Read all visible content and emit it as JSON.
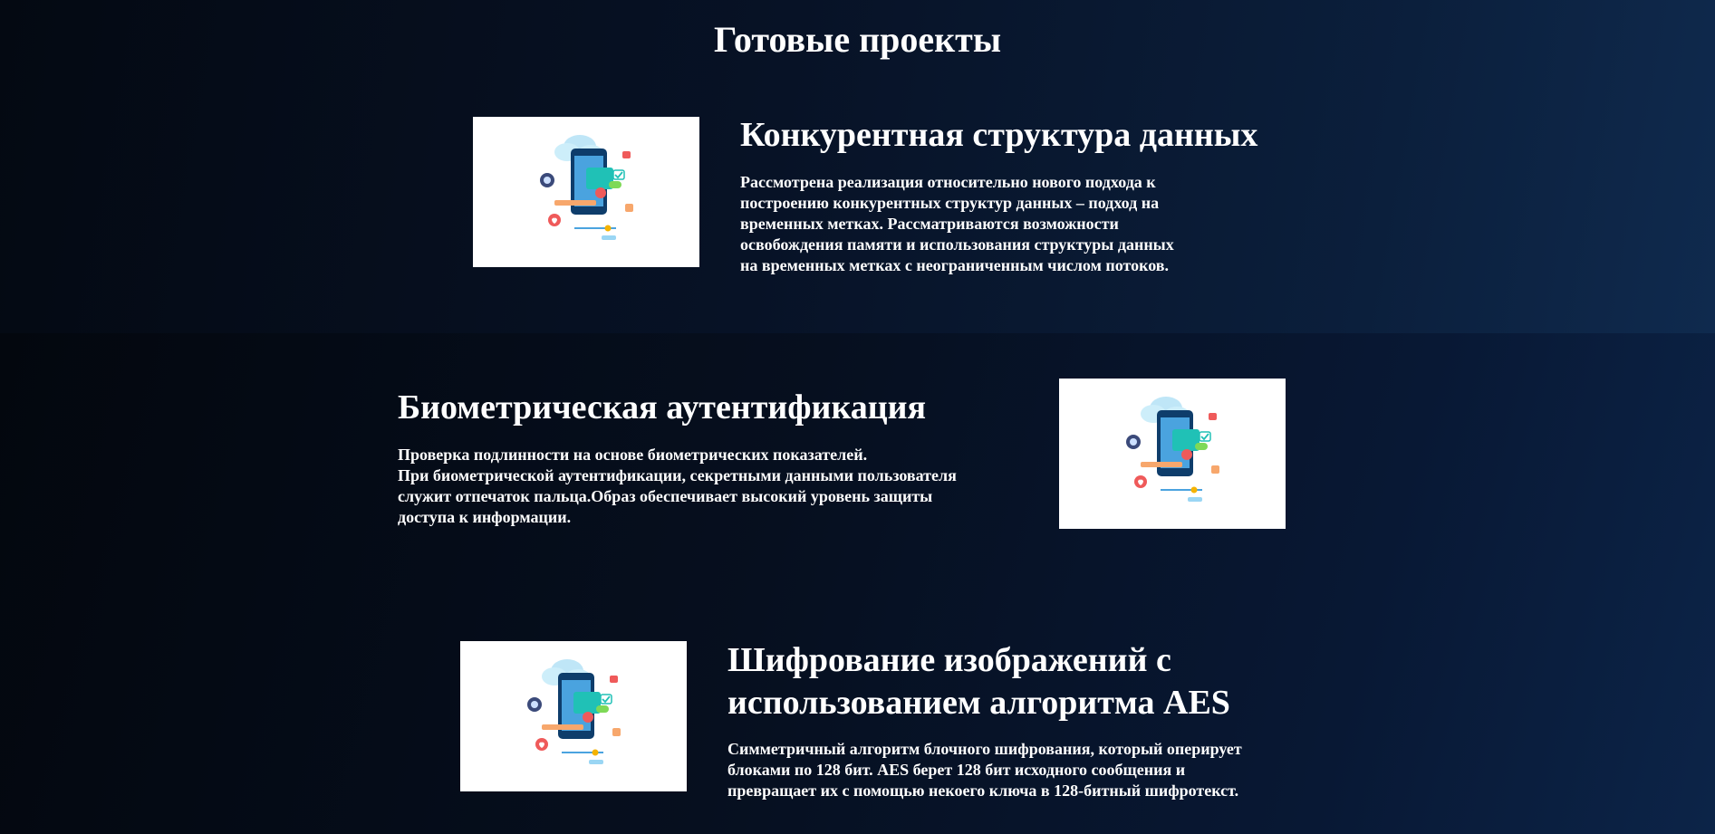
{
  "page": {
    "title": "Готовые проекты"
  },
  "projects": [
    {
      "title": "Конкурентная структура данных",
      "description": "Рассмотрена реализация относительно нового подхода к\nпостроению конкурентных структур данных – подход на\nвременных метках. Рассматриваются возможности\nосвобождения памяти и использования структуры данных\nна временных метках с неограниченным числом потоков.",
      "image_icon": "mobile-app-illustration-icon"
    },
    {
      "title": "Биометрическая аутентификация",
      "description": "Проверка подлинности на основе биометрических показателей.\nПри биометрической аутентификации, секретными данными пользователя\nслужит отпечаток пальца.Образ обеспечивает высокий уровень защиты\nдоступа к информации.",
      "image_icon": "mobile-app-illustration-icon"
    },
    {
      "title": "Шифрование изображений с\nиспользованием алгоритма AES",
      "description": "Симметричный алгоритм блочного шифрования, который оперирует\nблоками по 128 бит. AES берет 128 бит исходного сообщения и\nпревращает их с помощью некоего ключа в 128-битный шифротекст.",
      "image_icon": "mobile-app-illustration-icon"
    }
  ],
  "colors": {
    "text": "#ffffff",
    "background_dark": "#050b17",
    "background_accent": "#0f2a4e",
    "image_background": "#ffffff"
  }
}
